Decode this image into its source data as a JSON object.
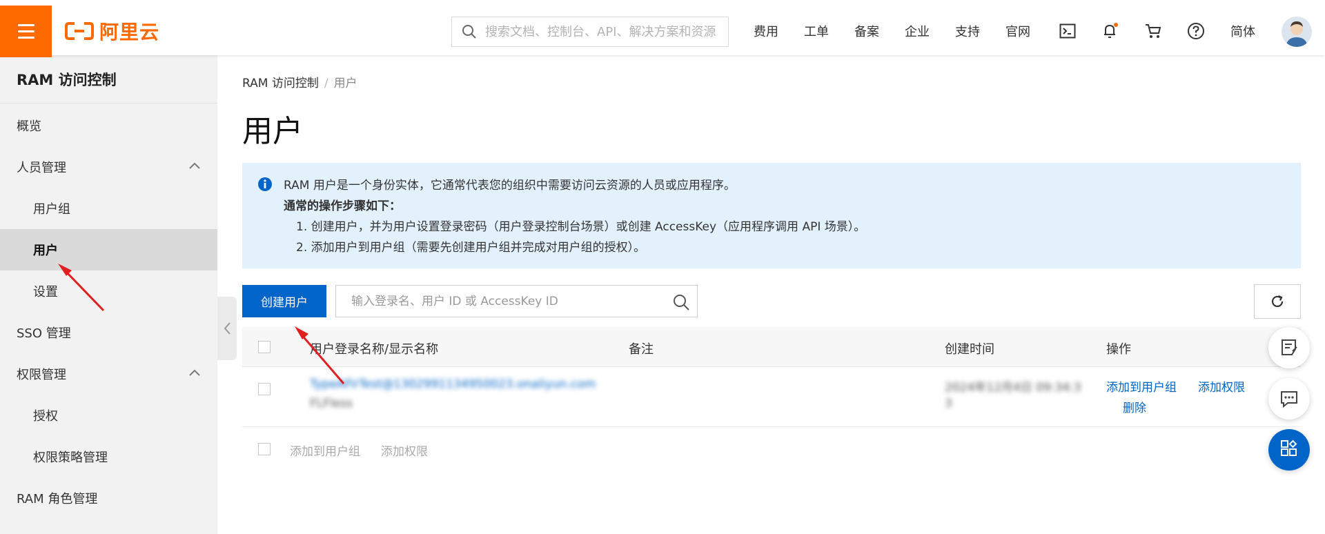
{
  "header": {
    "brand": "阿里云",
    "search_placeholder": "搜索文档、控制台、API、解决方案和资源",
    "nav": [
      "费用",
      "工单",
      "备案",
      "企业",
      "支持",
      "官网"
    ],
    "lang": "简体",
    "accent": "#ff6a00"
  },
  "sidebar": {
    "title": "RAM 访问控制",
    "items": [
      {
        "label": "概览"
      },
      {
        "label": "人员管理"
      },
      {
        "label": "用户组"
      },
      {
        "label": "用户"
      },
      {
        "label": "设置"
      },
      {
        "label": "SSO 管理"
      },
      {
        "label": "权限管理"
      },
      {
        "label": "授权"
      },
      {
        "label": "权限策略管理"
      },
      {
        "label": "RAM 角色管理"
      }
    ]
  },
  "breadcrumb": {
    "root": "RAM 访问控制",
    "sep": "/",
    "current": "用户"
  },
  "page": {
    "title": "用户"
  },
  "notice": {
    "line1": "RAM 用户是一个身份实体，它通常代表您的组织中需要访问云资源的人员或应用程序。",
    "heading": "通常的操作步骤如下：",
    "step1": "1. 创建用户，并为用户设置登录密码（用户登录控制台场景）或创建 AccessKey（应用程序调用 API 场景）。",
    "step2": "2. 添加用户到用户组（需要先创建用户组并完成对用户组的授权）。"
  },
  "toolbar": {
    "create_label": "创建用户",
    "search_placeholder": "输入登录名、用户 ID 或 AccessKey ID"
  },
  "table": {
    "columns": [
      "用户登录名称/显示名称",
      "备注",
      "创建时间",
      "操作"
    ],
    "rows": [
      {
        "login": "TypeAFirTest@1302991134950023.onaliyun.com",
        "display": "FLFless",
        "note": "",
        "created": "2024年12月4日 09:34:3",
        "created2": "3",
        "actions": [
          "添加到用户组",
          "添加权限",
          "删除"
        ]
      }
    ],
    "bulk_actions": [
      "添加到用户组",
      "添加权限"
    ]
  },
  "colors": {
    "primary": "#0064c8",
    "notice_bg": "#e3f1fd",
    "annotation_arrow": "#e02020"
  }
}
